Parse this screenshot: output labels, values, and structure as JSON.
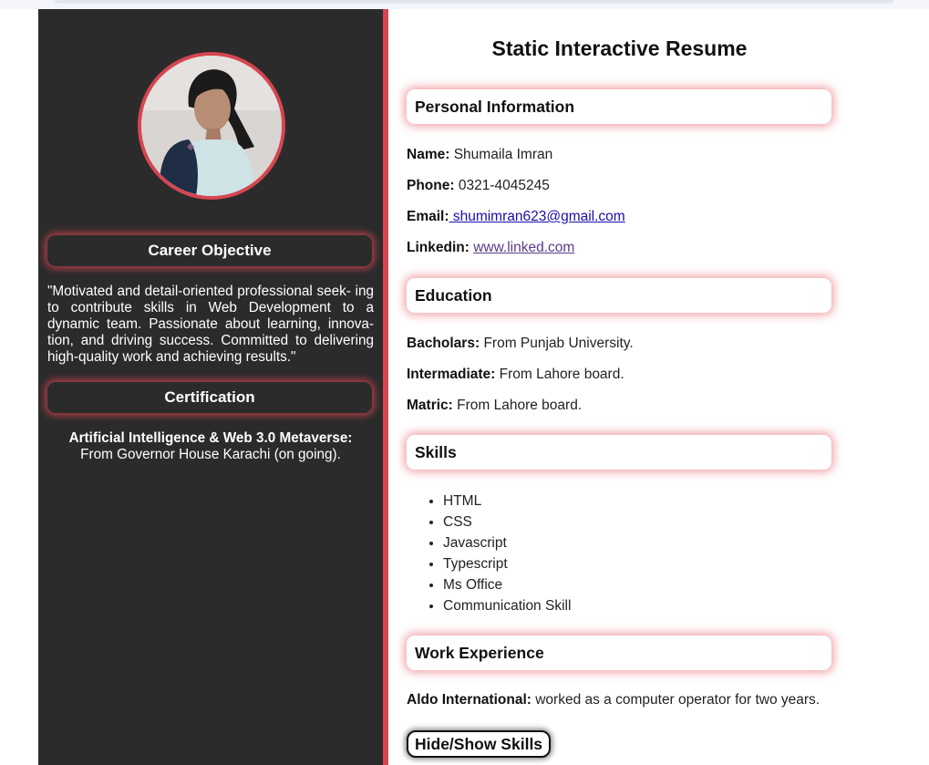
{
  "page": {
    "title": "Static Interactive Resume"
  },
  "sidebar": {
    "avatar_alt": "Profile photo",
    "career_heading": "Career Objective",
    "career_text": "\"Motivated and detail-oriented professional seek- ing to contribute skills in Web Development to a dynamic team. Passionate about learning, innova- tion, and driving success. Committed to delivering high-quality work and achieving results.\"",
    "cert_heading": "Certification",
    "cert_title": "Artificial Intelligence & Web 3.0 Metaverse:",
    "cert_detail": "From Governor House Karachi (on going)."
  },
  "personal": {
    "heading": "Personal Information",
    "name_label": "Name:",
    "name": "Shumaila Imran",
    "phone_label": "Phone:",
    "phone": "0321-4045245",
    "email_label": "Email:",
    "email": " shumimran623@gmail.com",
    "linkedin_label": "Linkedin:",
    "linkedin": "www.linked.com"
  },
  "education": {
    "heading": "Education",
    "items": [
      {
        "label": "Bacholars:",
        "value": "From Punjab University."
      },
      {
        "label": "Intermadiate:",
        "value": "From Lahore board."
      },
      {
        "label": "Matric:",
        "value": "From Lahore board."
      }
    ]
  },
  "skills": {
    "heading": "Skills",
    "items": [
      "HTML",
      "CSS",
      "Javascript",
      "Typescript",
      "Ms Office",
      "Communication Skill"
    ]
  },
  "work": {
    "heading": "Work Experience",
    "label": "Aldo International:",
    "value": "worked as a computer operator for two years."
  },
  "toggle_button": {
    "label": "Hide/Show Skills"
  },
  "colors": {
    "accent": "#d64550",
    "sidebar_bg": "#2b2b2b"
  }
}
